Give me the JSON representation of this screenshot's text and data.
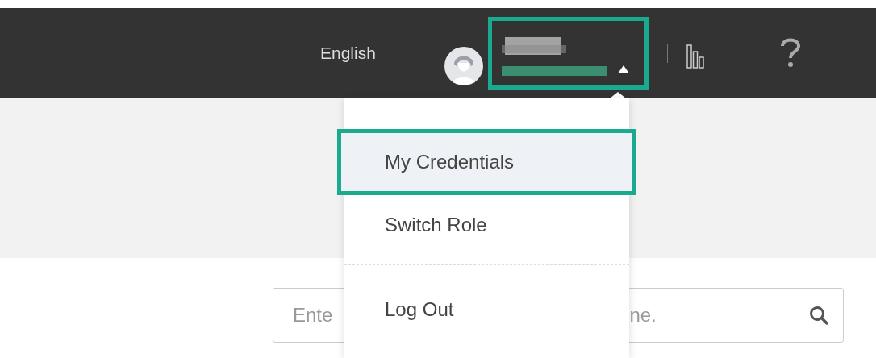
{
  "header": {
    "language": "English",
    "user_menu": {
      "expanded": true
    }
  },
  "menu": {
    "items": [
      {
        "label": "My Credentials",
        "selected": true,
        "highlighted": true
      },
      {
        "label": "Switch Role",
        "selected": false,
        "highlighted": false
      },
      {
        "label": "Log Out",
        "selected": false,
        "highlighted": false
      }
    ]
  },
  "search": {
    "placeholder_visible_start": "Ente",
    "placeholder_visible_end": "ne."
  }
}
